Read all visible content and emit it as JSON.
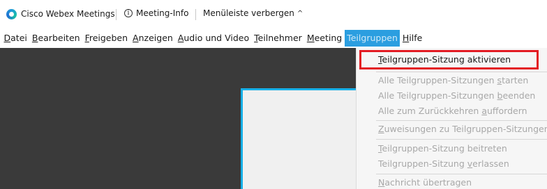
{
  "titlebar": {
    "app_name": "Cisco Webex Meetings",
    "info_label": "Meeting-Info",
    "hide_menu_label": "Menüleiste verbergen",
    "chevron": "^"
  },
  "menubar": {
    "items": [
      {
        "pre": "",
        "acc": "D",
        "post": "atei"
      },
      {
        "pre": "",
        "acc": "B",
        "post": "earbeiten"
      },
      {
        "pre": "",
        "acc": "F",
        "post": "reigeben"
      },
      {
        "pre": "",
        "acc": "A",
        "post": "nzeigen"
      },
      {
        "pre": "",
        "acc": "A",
        "post": "udio und Video"
      },
      {
        "pre": "",
        "acc": "T",
        "post": "eilnehmer"
      },
      {
        "pre": "",
        "acc": "M",
        "post": "eeting"
      },
      {
        "label": "Teilgruppen",
        "active": true
      },
      {
        "pre": "",
        "acc": "H",
        "post": "ilfe"
      }
    ],
    "active_color": "#2b9ee0"
  },
  "dropdown": {
    "items": [
      {
        "pre": "",
        "acc": "T",
        "post": "eilgruppen-Sitzung aktivieren",
        "enabled": true
      },
      {
        "pre": "Alle Teilgruppen-Sitzungen ",
        "acc": "s",
        "post": "tarten",
        "enabled": false
      },
      {
        "pre": "Alle Teilgruppen-Sitzungen ",
        "acc": "b",
        "post": "eenden",
        "enabled": false
      },
      {
        "pre": "Alle zum Zurückkehren ",
        "acc": "a",
        "post": "uffordern",
        "enabled": false
      },
      {
        "pre": "",
        "acc": "Z",
        "post": "uweisungen zu Teilgruppen-Sitzungen",
        "enabled": false
      },
      {
        "pre": "",
        "acc": "T",
        "post": "eilgruppen-Sitzung beitreten",
        "enabled": false
      },
      {
        "pre": "Teilgruppen-Sitzung ",
        "acc": "v",
        "post": "erlassen",
        "enabled": false
      },
      {
        "pre": "",
        "acc": "N",
        "post": "achricht übertragen",
        "enabled": false
      }
    ],
    "highlight_color": "#e31b23"
  },
  "meeting": {
    "panel_accent": "#17b0e8",
    "background": "#3a3a3a"
  }
}
